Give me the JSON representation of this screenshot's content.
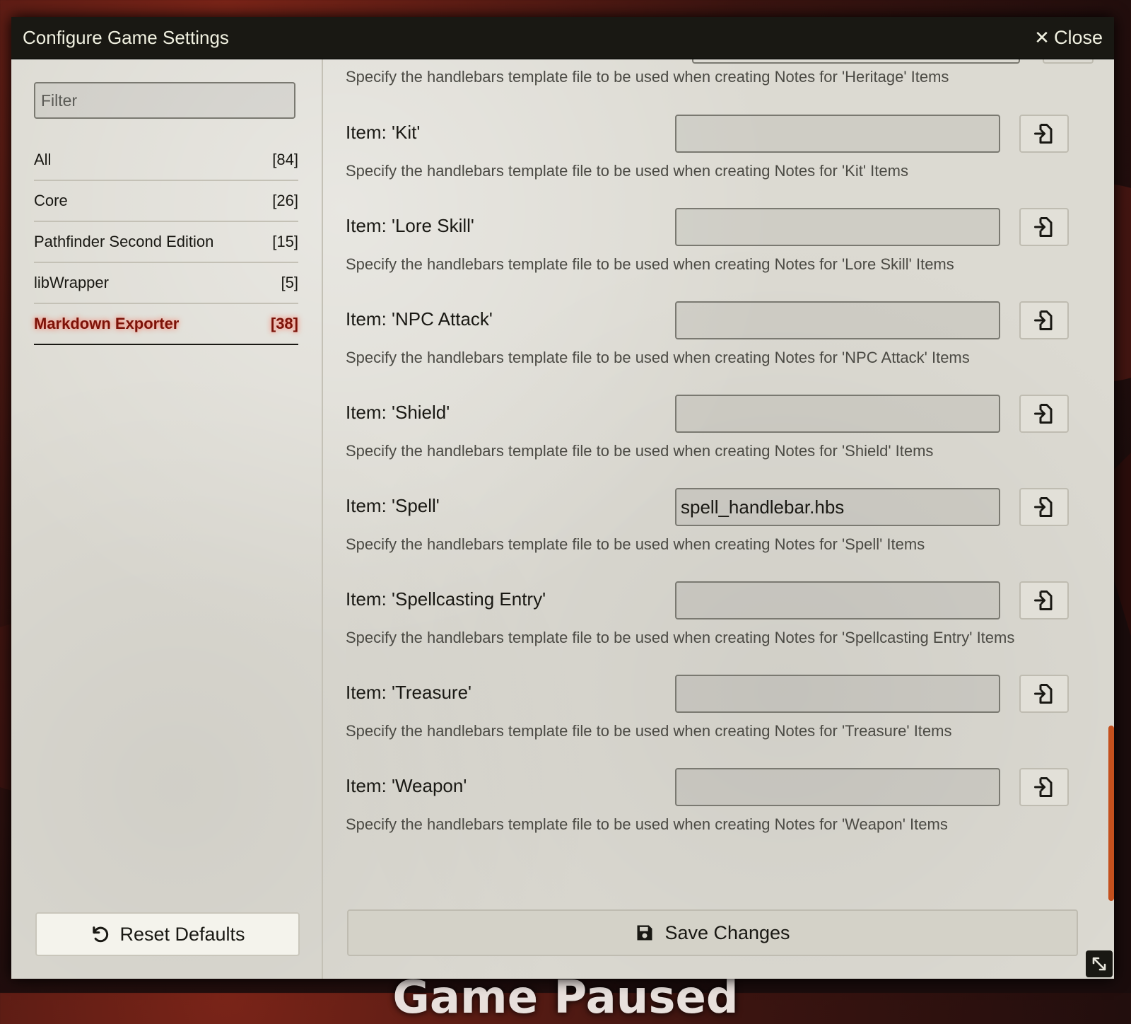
{
  "background": {
    "overlay_text": "Game Paused"
  },
  "window": {
    "title": "Configure Game Settings",
    "close_label": "Close"
  },
  "sidebar": {
    "filter_placeholder": "Filter",
    "categories": [
      {
        "label": "All",
        "count": "[84]"
      },
      {
        "label": "Core",
        "count": "[26]"
      },
      {
        "label": "Pathfinder Second Edition",
        "count": "[15]"
      },
      {
        "label": "libWrapper",
        "count": "[5]"
      },
      {
        "label": "Markdown Exporter",
        "count": "[38]",
        "active": true
      }
    ],
    "reset_label": "Reset Defaults"
  },
  "main": {
    "previous_hint": "Specify the handlebars template file to be used when creating Notes for 'Heritage' Items",
    "settings": [
      {
        "label": "Item: 'Kit'",
        "value": "",
        "hint": "Specify the handlebars template file to be used when creating Notes for 'Kit' Items"
      },
      {
        "label": "Item: 'Lore Skill'",
        "value": "",
        "hint": "Specify the handlebars template file to be used when creating Notes for 'Lore Skill' Items"
      },
      {
        "label": "Item: 'NPC Attack'",
        "value": "",
        "hint": "Specify the handlebars template file to be used when creating Notes for 'NPC Attack' Items"
      },
      {
        "label": "Item: 'Shield'",
        "value": "",
        "hint": "Specify the handlebars template file to be used when creating Notes for 'Shield' Items"
      },
      {
        "label": "Item: 'Spell'",
        "value": "spell_handlebar.hbs",
        "hint": "Specify the handlebars template file to be used when creating Notes for 'Spell' Items"
      },
      {
        "label": "Item: 'Spellcasting Entry'",
        "value": "",
        "hint": "Specify the handlebars template file to be used when creating Notes for 'Spellcasting Entry' Items"
      },
      {
        "label": "Item: 'Treasure'",
        "value": "",
        "hint": "Specify the handlebars template file to be used when creating Notes for 'Treasure' Items"
      },
      {
        "label": "Item: 'Weapon'",
        "value": "",
        "hint": "Specify the handlebars template file to be used when creating Notes for 'Weapon' Items"
      }
    ],
    "save_label": "Save Changes"
  },
  "colors": {
    "titlebar": "#191813",
    "active_category": "#7c1208",
    "scrollbar": "#c4501d"
  },
  "icons": {
    "close": "close-icon",
    "reset": "undo-icon",
    "file_picker": "file-import-icon",
    "save": "floppy-disk-icon",
    "resize": "resize-icon"
  }
}
